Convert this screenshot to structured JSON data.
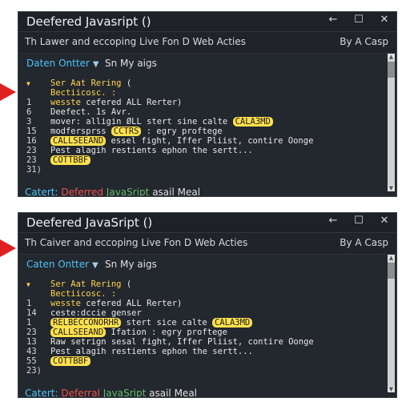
{
  "panels": [
    {
      "title": "Deefered Javasript ()",
      "controls": {
        "back": "←",
        "max": "☐",
        "close": "✕"
      },
      "subtitle_left": "Th Lawer and eccoping Live Fon D Web Acties",
      "subtitle_right": "By A Casp",
      "toolbar_link": "Daten Ontter",
      "toolbar_text": "Sn My aigs",
      "code_lines": [
        {
          "num": "",
          "segments": [
            {
              "t": "Ser Aat Rering",
              "c": "kw"
            },
            {
              "t": " (",
              "c": "tx"
            }
          ]
        },
        {
          "num": "",
          "segments": [
            {
              "t": "Bectiicosc. :",
              "c": "kw"
            }
          ]
        },
        {
          "num": "1",
          "segments": [
            {
              "t": "wesste",
              "c": "kw"
            },
            {
              "t": " cefered ALL Rerter)",
              "c": "tx"
            }
          ]
        },
        {
          "num": "6",
          "segments": [
            {
              "t": "Deefect. 1s Avr.",
              "c": "tx"
            }
          ]
        },
        {
          "num": "3",
          "segments": [
            {
              "t": "mover: alligin ØLL stert sine calte ",
              "c": "tx"
            },
            {
              "t": "CALA3MD",
              "c": "hl"
            }
          ]
        },
        {
          "num": "15",
          "segments": [
            {
              "t": "modfersprss ",
              "c": "tx"
            },
            {
              "t": "CCTRS",
              "c": "hl"
            },
            {
              "t": " : egry proftege",
              "c": "tx"
            }
          ]
        },
        {
          "num": "16",
          "segments": [
            {
              "t": "CALLSEEAND",
              "c": "hl"
            },
            {
              "t": " essel fight, Iffer Pliist, contire Oonge",
              "c": "tx"
            }
          ]
        },
        {
          "num": "23",
          "segments": [
            {
              "t": "Pest alagih restients ephon the sertt...",
              "c": "tx"
            }
          ]
        },
        {
          "num": "23",
          "segments": [
            {
              "t": "COTTBBF",
              "c": "hl"
            }
          ]
        },
        {
          "num": "31)",
          "segments": []
        }
      ],
      "status": {
        "a": "Catert:",
        "b": "Deferred",
        "c": "JavaSript",
        "d": "asail Meal"
      }
    },
    {
      "title": "Deefered JavaSript ()",
      "controls": {
        "back": "←",
        "max": "☐",
        "close": "✕"
      },
      "subtitle_left": "Th Caiver and eccoping Live Fon D Web Acties",
      "subtitle_right": "By A Casp",
      "toolbar_link": "Caten Ontter",
      "toolbar_text": "Sn My aigs",
      "code_lines": [
        {
          "num": "",
          "segments": [
            {
              "t": "Ser Aat Rering",
              "c": "kw"
            },
            {
              "t": " (",
              "c": "tx"
            }
          ]
        },
        {
          "num": "",
          "segments": [
            {
              "t": "Bectiicosc. :",
              "c": "kw"
            }
          ]
        },
        {
          "num": "1",
          "segments": [
            {
              "t": "wesste",
              "c": "kw"
            },
            {
              "t": " cefered ALL Rerter)",
              "c": "tx"
            }
          ]
        },
        {
          "num": "14",
          "segments": [
            {
              "t": "ceste:dccie genser",
              "c": "tx"
            }
          ]
        },
        {
          "num": "1",
          "segments": [
            {
              "t": "RELBECCONORHR",
              "c": "hl"
            },
            {
              "t": " stert sice calte ",
              "c": "tx"
            },
            {
              "t": "CALA3MD",
              "c": "hl"
            }
          ]
        },
        {
          "num": "23",
          "segments": [
            {
              "t": "CALLSEEAND",
              "c": "hl"
            },
            {
              "t": " Ifation : egry proftege",
              "c": "tx"
            }
          ]
        },
        {
          "num": "13",
          "segments": [
            {
              "t": "Raw setrign sesal fight, Iffer Pliist, contire Oonge",
              "c": "tx"
            }
          ]
        },
        {
          "num": "43",
          "segments": [
            {
              "t": "Pest alagih restients ephon the sertt...",
              "c": "tx"
            }
          ]
        },
        {
          "num": "55",
          "segments": [
            {
              "t": "COTTBBF",
              "c": "hl"
            }
          ]
        },
        {
          "num": "23)",
          "segments": []
        }
      ],
      "status": {
        "a": "Catert:",
        "b": "Deferral",
        "c": "JavaSript",
        "d": "asail Meal"
      }
    }
  ]
}
